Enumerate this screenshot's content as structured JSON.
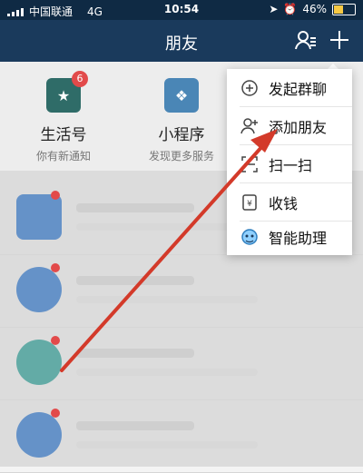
{
  "status_bar": {
    "carrier": "中国联通",
    "network": "4G",
    "time": "10:54",
    "battery": "46%",
    "battery_level": 0.46
  },
  "header": {
    "title": "朋友"
  },
  "shortcuts": [
    {
      "title": "生活号",
      "subtitle": "你有新通知",
      "badge": "6"
    },
    {
      "title": "小程序",
      "subtitle": "发现更多服务"
    }
  ],
  "menu": {
    "items": [
      {
        "label": "发起群聊",
        "icon": "plus-circle-icon"
      },
      {
        "label": "添加朋友",
        "icon": "add-person-icon"
      },
      {
        "label": "扫一扫",
        "icon": "scan-icon"
      },
      {
        "label": "收钱",
        "icon": "receive-money-icon"
      },
      {
        "label": "智能助理",
        "icon": "assistant-icon"
      }
    ]
  },
  "colors": {
    "header_bg": "#1a3a5c",
    "arrow": "#d33a2a",
    "badge": "#e24a4a"
  }
}
